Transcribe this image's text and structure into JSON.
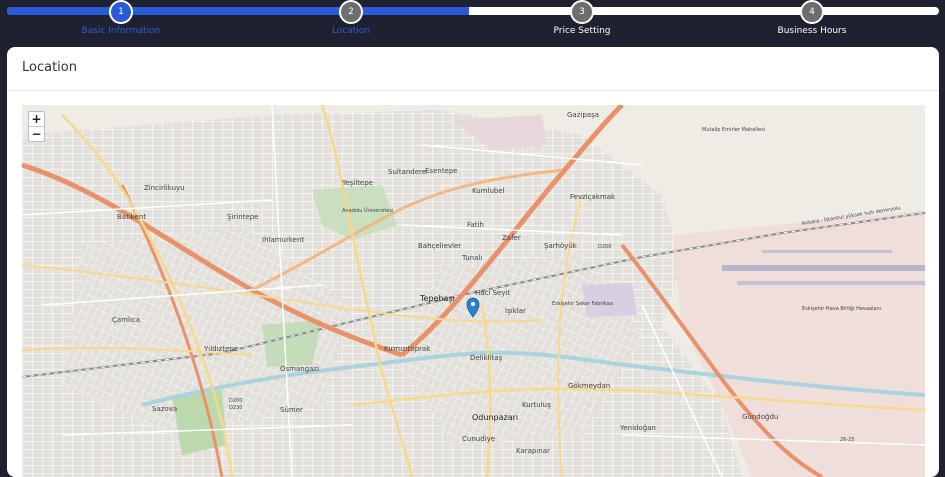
{
  "stepper": {
    "progress_percent": 49.6,
    "steps": [
      {
        "number": "1",
        "label": "Basic Information",
        "state": "active"
      },
      {
        "number": "2",
        "label": "Location",
        "state": "done"
      },
      {
        "number": "3",
        "label": "Price Setting",
        "state": "pending"
      },
      {
        "number": "4",
        "label": "Business Hours",
        "state": "pending"
      }
    ]
  },
  "card": {
    "title": "Location"
  },
  "map": {
    "zoom_in": "+",
    "zoom_out": "−",
    "marker_icon": "map-pin-icon",
    "places": {
      "gazipasa": "Gazipaşa",
      "mutalip": "Mutalip Emirler Mahallesi",
      "zincirlikuyu": "Zincirlikuyu",
      "batikent": "Batıkent",
      "sirintepe": "Şirintepe",
      "yesiltepe": "Yeşiltepe",
      "sultandere": "Sultandere",
      "esentepe": "Esentepe",
      "kumlubel": "Kumlubel",
      "fevzicakmak": "Fevziçakmak",
      "ihlamurkent": "Ihlamurkent",
      "anadolu": "Anadolu Üniversitesi",
      "fatih": "Fatih",
      "zafer": "Zafer",
      "sarhoyuk": "Şarhöyük",
      "bahcelievler": "Bahçelievler",
      "tunali": "Tunalı",
      "eskisehir_havaalani": "Eskişehir Hava Birliği Havaalanı",
      "camlica": "Çamlıca",
      "tepebasi": "Tepebaşı",
      "haci_seyit": "Hacı Seyit",
      "isiklar": "Işıklar",
      "seker_fabrikasi": "Eskişehir Şeker Fabrikası",
      "kirmizitoprak": "Kırmızıtoprak",
      "deliklitas": "Deliklitaş",
      "yildiztepe": "Yıldıztepe",
      "osmangazi": "Osmangazi",
      "gokmeydan": "Gökmeydan",
      "sumer": "Sümer",
      "odunpazari": "Odunpazarı",
      "kurtulus": "Kurtuluş",
      "gundogdu": "Gündoğdu",
      "sazova": "Sazova",
      "yenidogan": "Yenidoğan",
      "cunudiye": "Cunudiye",
      "karapinar": "Karapınar",
      "road_d200": "D200",
      "road_d230": "D230",
      "road_2625": "26-25",
      "rail_label": "Ankara - İstanbul yüksek hızlı demiryolu"
    }
  }
}
